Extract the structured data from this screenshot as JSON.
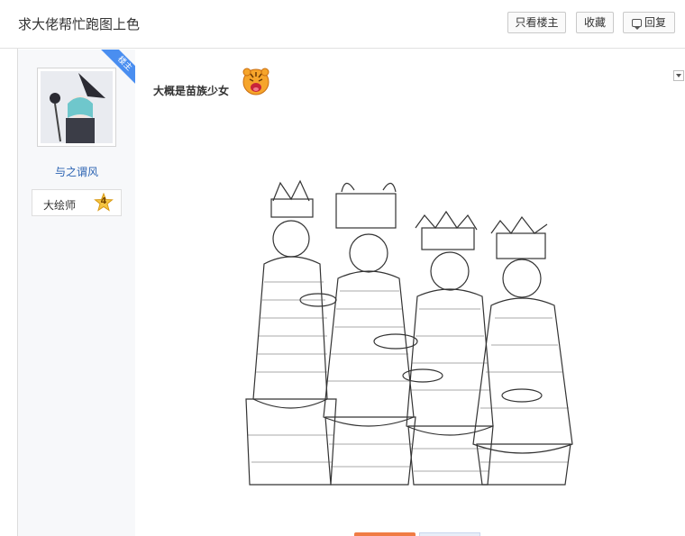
{
  "thread": {
    "title": "求大佬帮忙跑图上色"
  },
  "toolbar": {
    "only_op_label": "只看楼主",
    "favorite_label": "收藏",
    "reply_label": "回复"
  },
  "author": {
    "badge_label": "楼主",
    "username": "与之谓风",
    "rank_title": "大绘师",
    "rank_level": "4"
  },
  "post": {
    "text": "大概是苗族少女"
  },
  "colors": {
    "accent": "#2d64b3",
    "badge_blue": "#4a8ef0",
    "pager_orange": "#f07c44"
  }
}
